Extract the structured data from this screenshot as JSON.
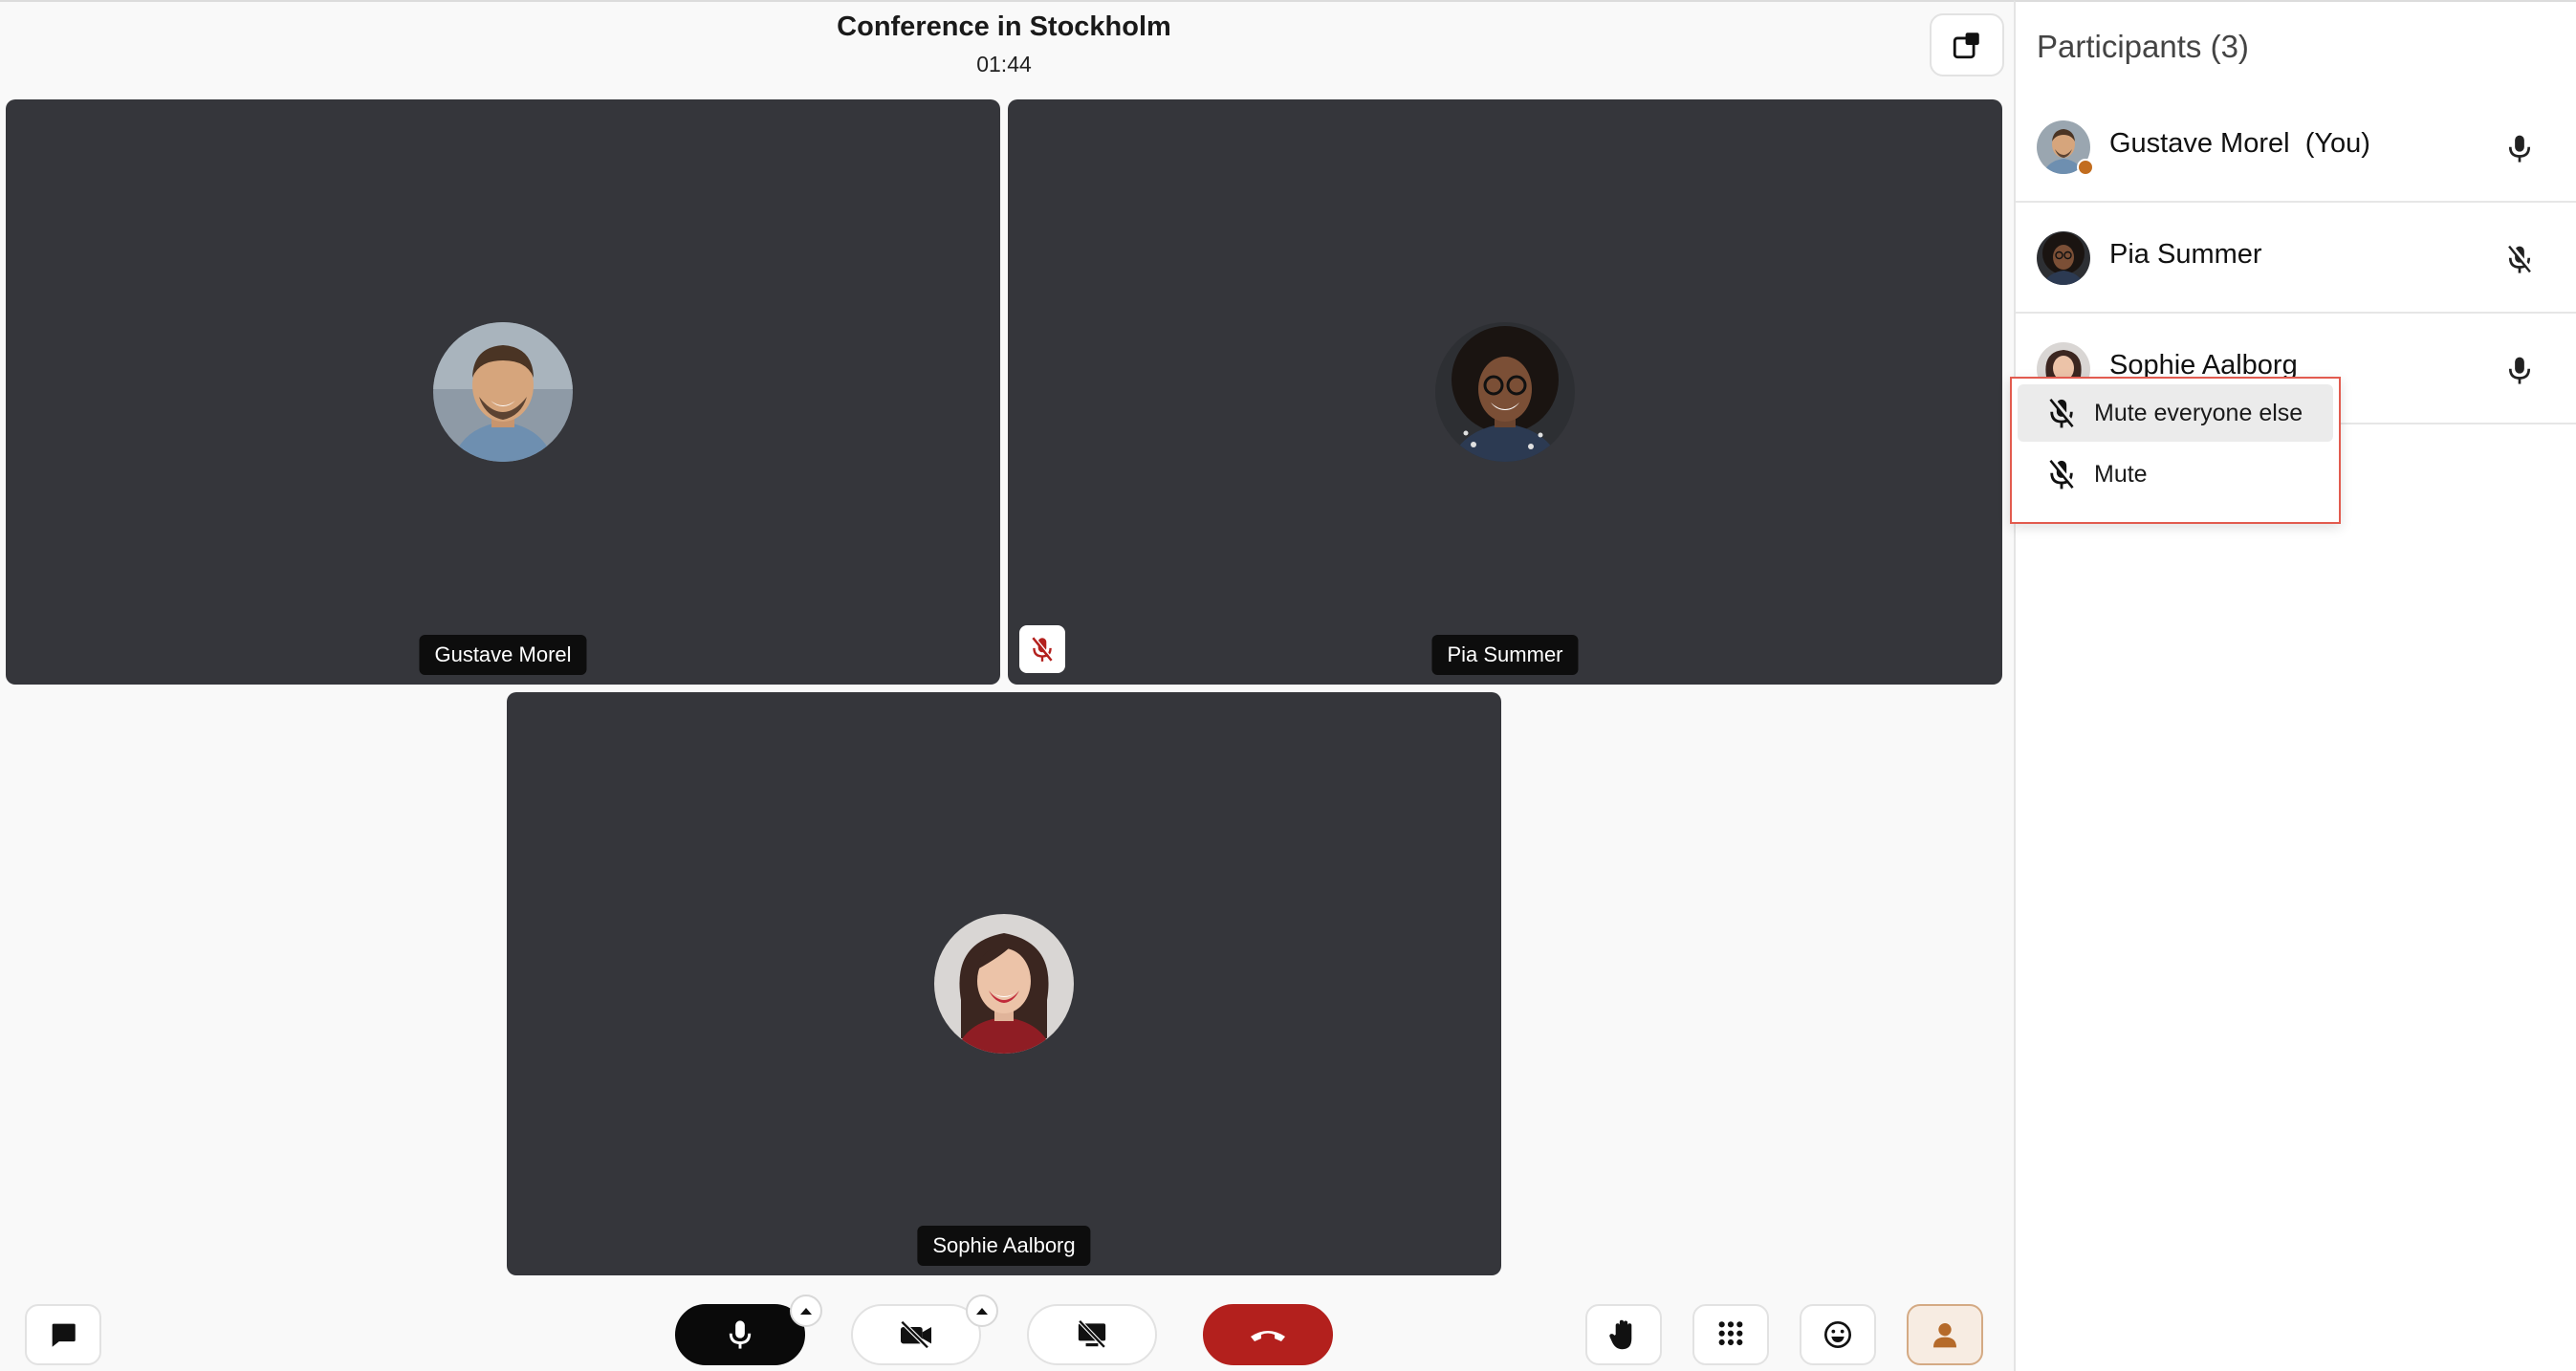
{
  "header": {
    "title": "Conference in Stockholm",
    "timer": "01:44"
  },
  "tiles": [
    {
      "name": "Gustave Morel",
      "muted": false
    },
    {
      "name": "Pia Summer",
      "muted": true
    },
    {
      "name": "Sophie Aalborg",
      "muted": false
    }
  ],
  "sidebar": {
    "title": "Participants (3)",
    "participants": [
      {
        "name": "Gustave Morel",
        "suffix": "(You)",
        "mic": "mic-icon"
      },
      {
        "name": "Pia Summer",
        "suffix": "",
        "mic": "mic-off-icon"
      },
      {
        "name": "Sophie Aalborg",
        "suffix": "",
        "mic": "mic-icon"
      }
    ]
  },
  "context_menu": {
    "items": [
      {
        "label": "Mute everyone else",
        "icon": "mic-off-icon"
      },
      {
        "label": "Mute",
        "icon": "mic-off-icon"
      }
    ]
  },
  "controls": {
    "chat": "chat-icon",
    "mic": "mic-icon",
    "camera": "camera-off-icon",
    "screen_share": "screen-share-off-icon",
    "hangup": "phone-hangup-icon",
    "raise_hand": "hand-icon",
    "dialpad": "dialpad-icon",
    "reactions": "emoji-icon",
    "participants": "person-icon"
  },
  "colors": {
    "tile_bg": "#35363b",
    "hangup": "#b3201d",
    "highlight_border": "#e25b4f",
    "muted_icon": "#b3201d"
  }
}
